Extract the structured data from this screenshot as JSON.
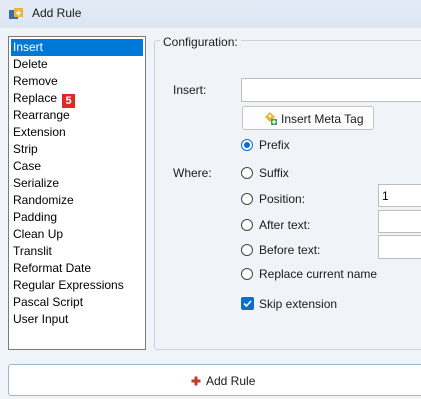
{
  "window": {
    "title": "Add Rule"
  },
  "rules": [
    "Insert",
    "Delete",
    "Remove",
    "Replace",
    "Rearrange",
    "Extension",
    "Strip",
    "Case",
    "Serialize",
    "Randomize",
    "Padding",
    "Clean Up",
    "Translit",
    "Reformat Date",
    "Regular Expressions",
    "Pascal Script",
    "User Input"
  ],
  "selected_rule": "Insert",
  "replace_badge": "5",
  "config": {
    "legend": "Configuration:",
    "insert_label": "Insert:",
    "insert_value": "",
    "meta_tag_button": "Insert Meta Tag",
    "where_label": "Where:",
    "options": {
      "prefix": "Prefix",
      "suffix": "Suffix",
      "position": "Position:",
      "after_text": "After text:",
      "before_text": "Before text:",
      "replace_current": "Replace current name"
    },
    "selected_option": "prefix",
    "position_value": "1",
    "after_text_value": "",
    "before_text_value": "",
    "skip_extension_label": "Skip extension",
    "skip_extension_checked": true
  },
  "add_rule_button": "Add Rule",
  "colors": {
    "accent": "#0a6ed1",
    "selection": "#0078d7",
    "badge": "#e32626"
  }
}
